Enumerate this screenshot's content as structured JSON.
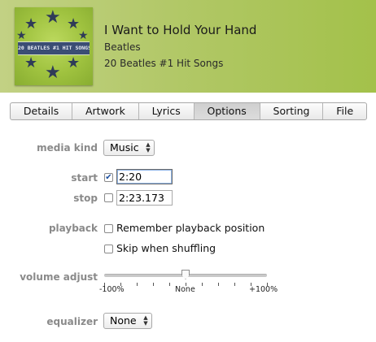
{
  "header": {
    "title": "I Want to Hold Your Hand",
    "artist": "Beatles",
    "album": "20 Beatles #1 Hit Songs",
    "artwork_text": "20 BEATLES #1 HIT SONGS",
    "artwork_colors": {
      "background": "#9fc23f",
      "banner": "#3b4d74",
      "stars": "#2f3b58"
    }
  },
  "tabs": [
    {
      "label": "Details",
      "active": false
    },
    {
      "label": "Artwork",
      "active": false
    },
    {
      "label": "Lyrics",
      "active": false
    },
    {
      "label": "Options",
      "active": true
    },
    {
      "label": "Sorting",
      "active": false
    },
    {
      "label": "File",
      "active": false
    }
  ],
  "options": {
    "media_kind": {
      "label": "media kind",
      "value": "Music"
    },
    "start": {
      "label": "start",
      "checked": true,
      "value": "2:20"
    },
    "stop": {
      "label": "stop",
      "checked": false,
      "value": "2:23.173"
    },
    "playback": {
      "label": "playback",
      "remember_position": {
        "label": "Remember playback position",
        "checked": false
      },
      "skip_shuffling": {
        "label": "Skip when shuffling",
        "checked": false
      }
    },
    "volume_adjust": {
      "label": "volume adjust",
      "min_label": "-100%",
      "mid_label": "None",
      "max_label": "+100%",
      "value_fraction": 0.5
    },
    "equalizer": {
      "label": "equalizer",
      "value": "None"
    }
  },
  "icons": {
    "checkmark": "checkmark-icon",
    "select_arrows": "up-down-arrows-icon",
    "stars": "star-icon"
  }
}
